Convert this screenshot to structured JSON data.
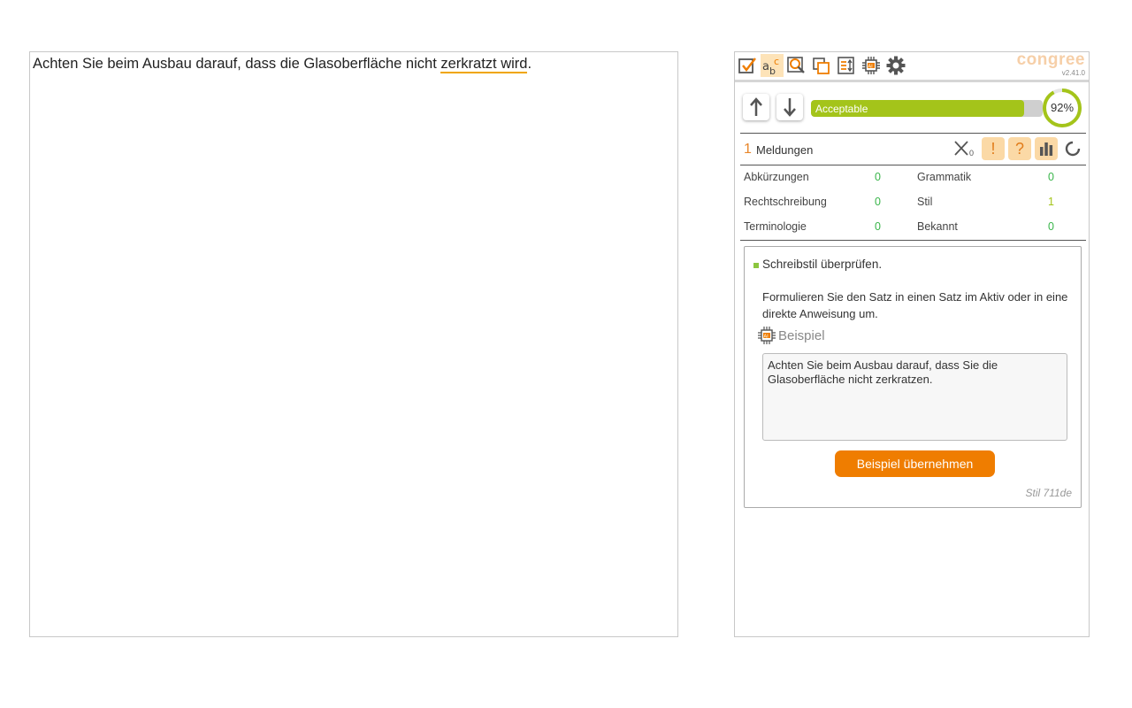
{
  "editor": {
    "text_before": "Achten Sie beim Ausbau darauf, dass die Glasoberfläche nicht ",
    "flagged_text": "zerkratzt wird",
    "text_after": "."
  },
  "toolbar": {
    "buttons": [
      "check-icon",
      "spelling-abc-icon",
      "search-icon",
      "copy-icon",
      "transfer-icon",
      "ai-chip-icon",
      "gear-icon"
    ],
    "brand": "congree",
    "version": "v2.41.0"
  },
  "score": {
    "label": "Acceptable",
    "percent": "92%",
    "value": 0.92,
    "bar_color": "#a4c41a"
  },
  "messages": {
    "count": "1",
    "label": "Meldungen",
    "filter_count": "0"
  },
  "stats": {
    "left": [
      {
        "name": "Abkürzungen",
        "value": "0"
      },
      {
        "name": "Rechtschreibung",
        "value": "0"
      },
      {
        "name": "Terminologie",
        "value": "0"
      }
    ],
    "right": [
      {
        "name": "Grammatik",
        "value": "0"
      },
      {
        "name": "Stil",
        "value": "1"
      },
      {
        "name": "Bekannt",
        "value": "0"
      }
    ]
  },
  "card": {
    "title": "Schreibstil überprüfen.",
    "description": "Formulieren Sie den Satz in einen Satz im Aktiv oder in eine direkte Anweisung um.",
    "example_label": "Beispiel",
    "example_text": "Achten Sie beim Ausbau darauf, dass Sie die Glasoberfläche nicht zerkratzen.",
    "apply_button": "Beispiel übernehmen",
    "rule_id": "Stil 711de"
  },
  "colors": {
    "accent": "#ef7d00",
    "ok": "#39b54a",
    "warn": "#a4c41a"
  }
}
